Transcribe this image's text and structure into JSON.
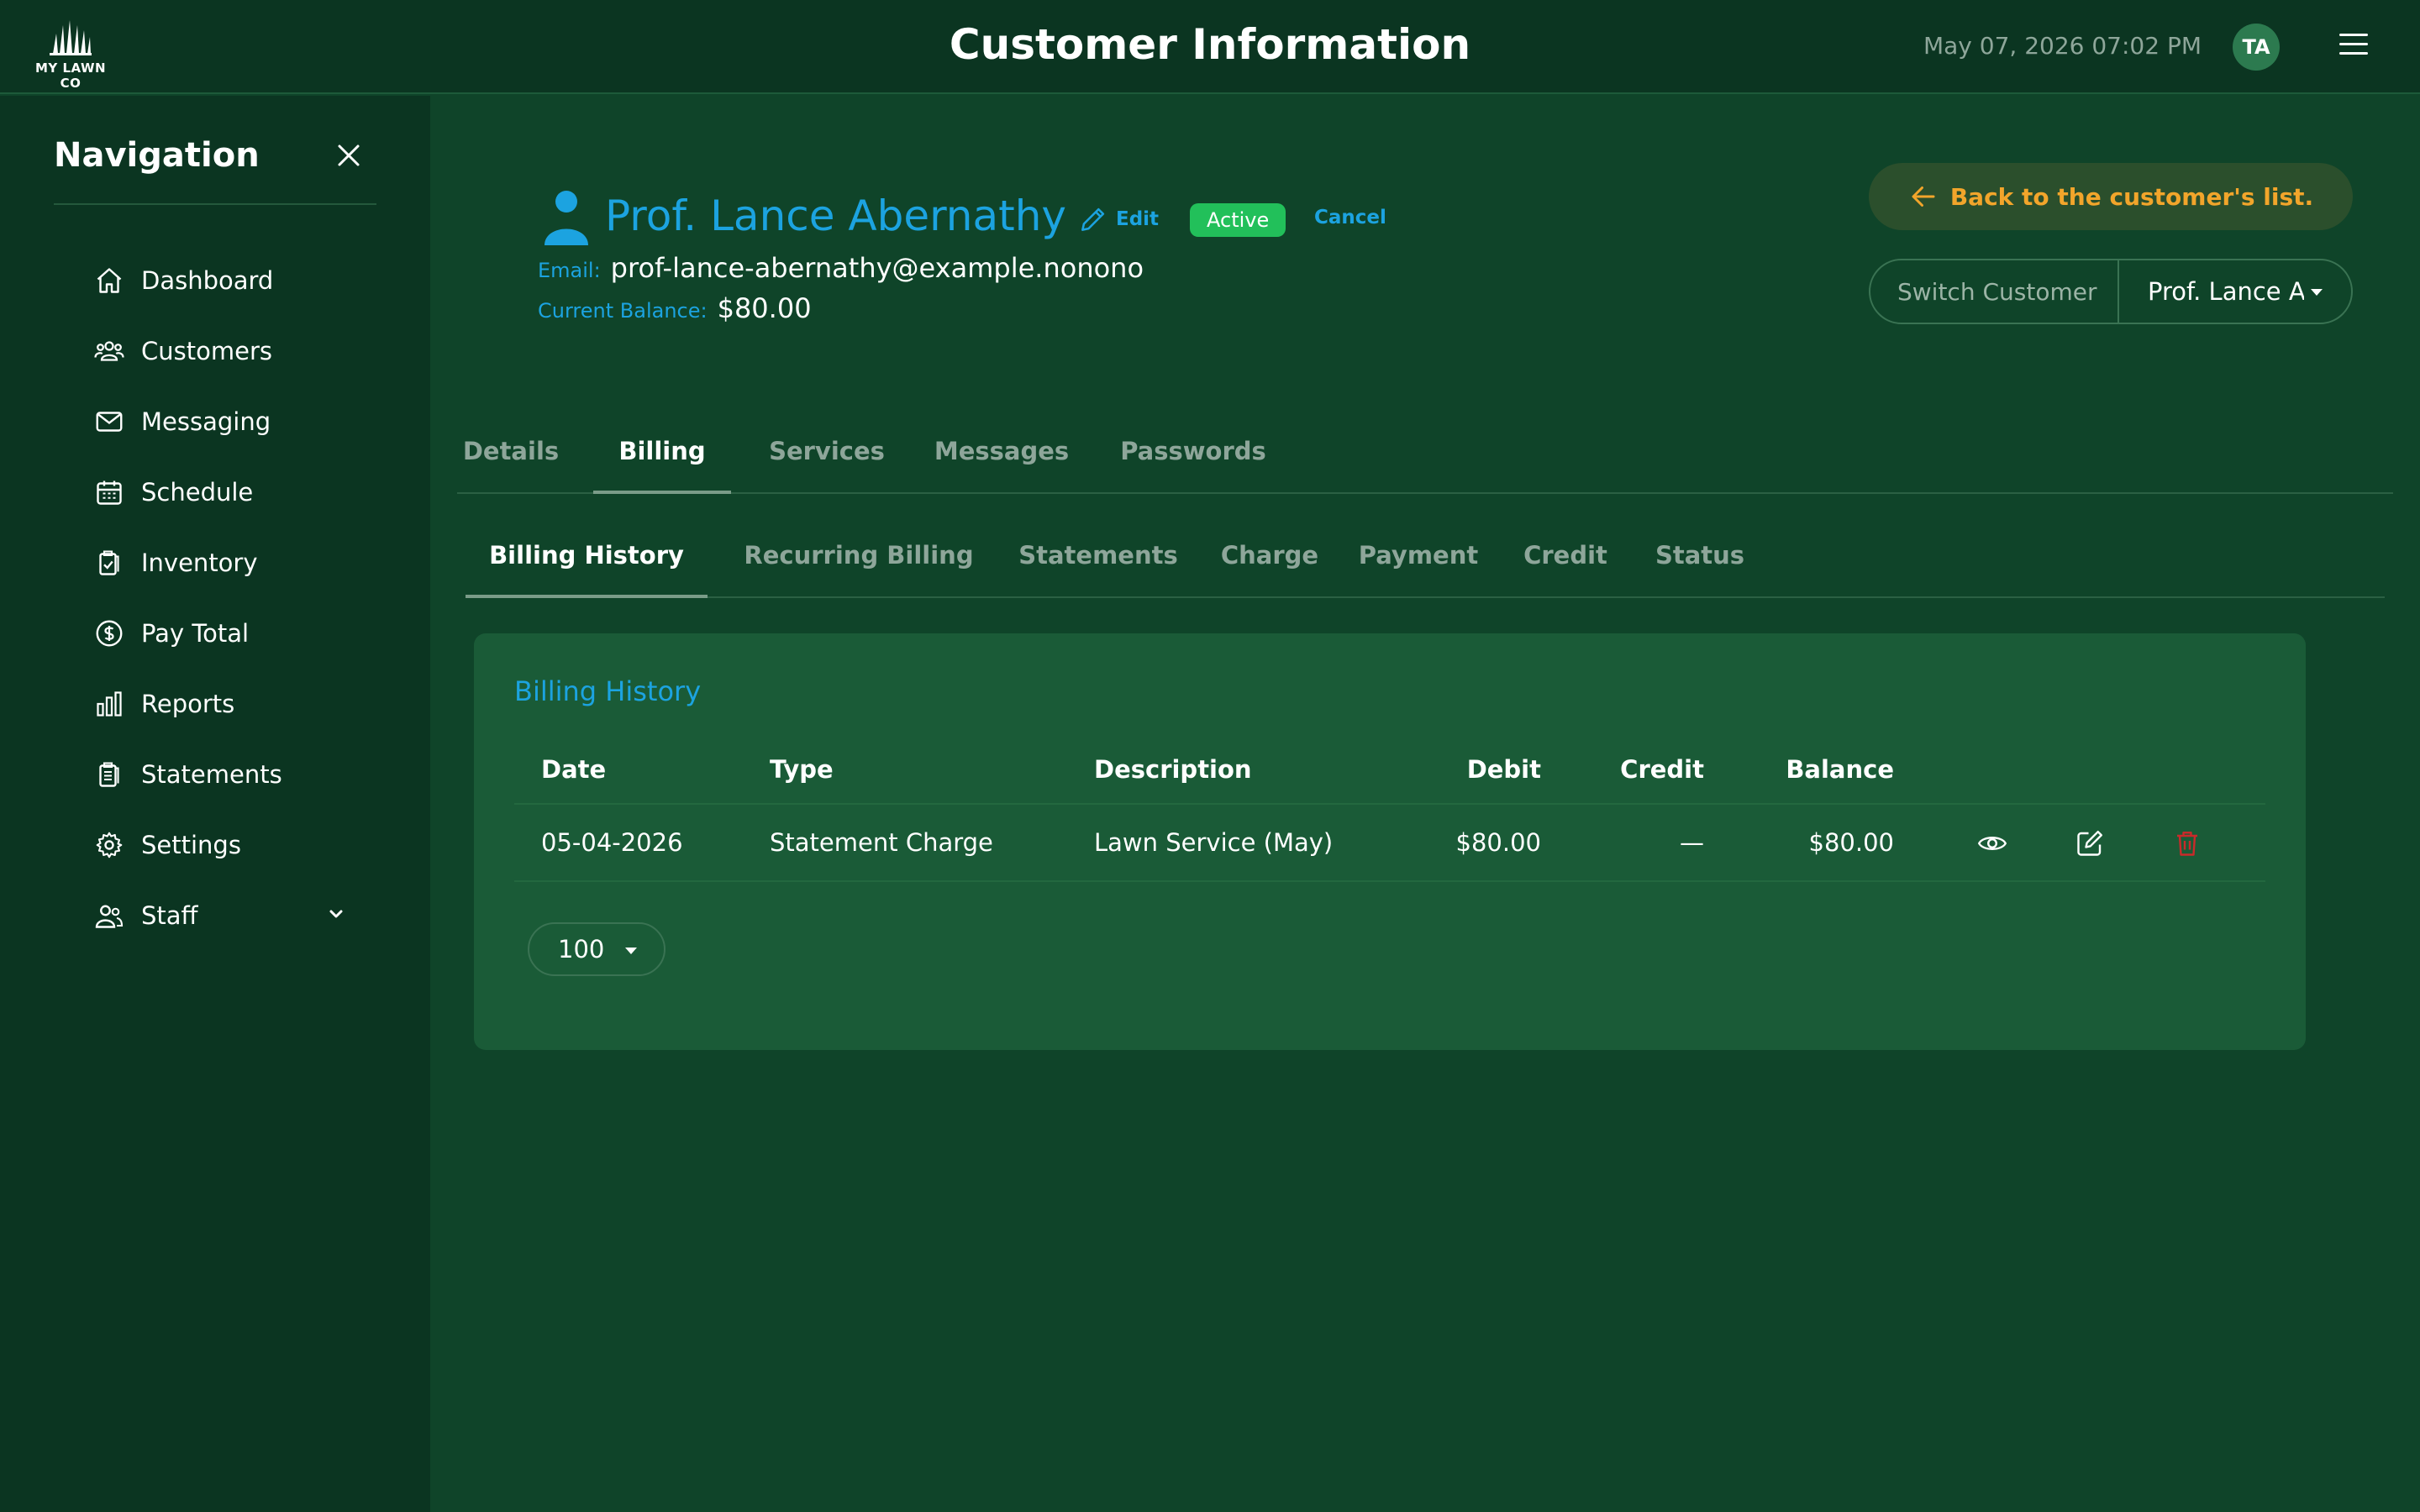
{
  "header": {
    "logo_text": "MY LAWN CO",
    "title": "Customer Information",
    "datetime": "May 07, 2026 07:02 PM",
    "avatar_initials": "TA"
  },
  "sidebar": {
    "title": "Navigation",
    "items": [
      {
        "label": "Dashboard",
        "icon": "home-icon"
      },
      {
        "label": "Customers",
        "icon": "users-icon"
      },
      {
        "label": "Messaging",
        "icon": "envelope-icon"
      },
      {
        "label": "Schedule",
        "icon": "calendar-icon"
      },
      {
        "label": "Inventory",
        "icon": "clipboard-check-icon"
      },
      {
        "label": "Pay Total",
        "icon": "dollar-circle-icon"
      },
      {
        "label": "Reports",
        "icon": "bar-chart-icon"
      },
      {
        "label": "Statements",
        "icon": "document-list-icon"
      },
      {
        "label": "Settings",
        "icon": "gear-icon"
      },
      {
        "label": "Staff",
        "icon": "staff-icon"
      }
    ]
  },
  "customer": {
    "name": "Prof. Lance Abernathy",
    "edit_label": "Edit",
    "status": "Active",
    "cancel_label": "Cancel",
    "email_label": "Email:",
    "email": "prof-lance-abernathy@example.nonono",
    "balance_label": "Current Balance:",
    "balance": "$80.00"
  },
  "actions": {
    "back_label": "Back to the customer's list.",
    "switch_label": "Switch Customer",
    "switch_value": "Prof. Lance Abernathy"
  },
  "tabs": {
    "main": [
      "Details",
      "Billing",
      "Services",
      "Messages",
      "Passwords"
    ],
    "main_active": "Billing",
    "sub": [
      "Billing History",
      "Recurring Billing",
      "Statements",
      "Charge",
      "Payment",
      "Credit",
      "Status"
    ],
    "sub_active": "Billing History"
  },
  "billing": {
    "title": "Billing History",
    "columns": [
      "Date",
      "Type",
      "Description",
      "Debit",
      "Credit",
      "Balance"
    ],
    "rows": [
      {
        "date": "05-04-2026",
        "type": "Statement Charge",
        "description": "Lawn Service (May)",
        "debit": "$80.00",
        "credit": "—",
        "balance": "$80.00"
      }
    ],
    "per_page": "100"
  },
  "colors": {
    "background": "#0f4429",
    "panel": "#0b3521",
    "card": "#1a5b37",
    "link": "#1ca3e0",
    "status_active": "#22c05a",
    "back_accent": "#f2a52b",
    "delete": "#c92a2a"
  }
}
